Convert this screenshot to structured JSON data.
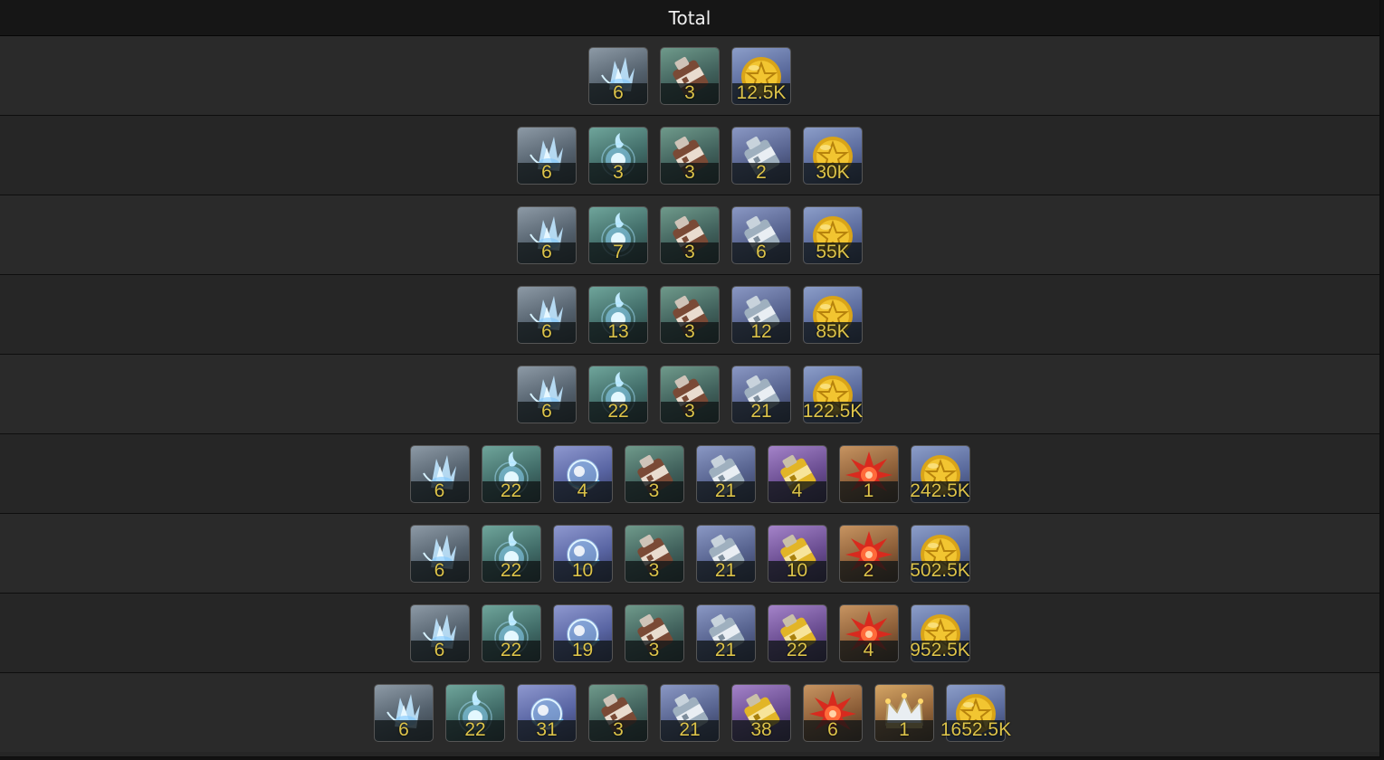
{
  "header": {
    "title": "Total"
  },
  "rows": [
    [
      {
        "icon": "crystal-shard-icon",
        "type": "shard",
        "count": "6"
      },
      {
        "icon": "brown-canister-icon",
        "type": "can-brown",
        "count": "3"
      },
      {
        "icon": "gold-coin-icon",
        "type": "coin",
        "count": "12.5K"
      }
    ],
    [
      {
        "icon": "crystal-shard-icon",
        "type": "shard",
        "count": "6"
      },
      {
        "icon": "spirit-orb-icon",
        "type": "orb",
        "count": "3"
      },
      {
        "icon": "brown-canister-icon",
        "type": "can-brown",
        "count": "3"
      },
      {
        "icon": "silver-canister-icon",
        "type": "can-silver",
        "count": "2"
      },
      {
        "icon": "gold-coin-icon",
        "type": "coin",
        "count": "30K"
      }
    ],
    [
      {
        "icon": "crystal-shard-icon",
        "type": "shard",
        "count": "6"
      },
      {
        "icon": "spirit-orb-icon",
        "type": "orb",
        "count": "7"
      },
      {
        "icon": "brown-canister-icon",
        "type": "can-brown",
        "count": "3"
      },
      {
        "icon": "silver-canister-icon",
        "type": "can-silver",
        "count": "6"
      },
      {
        "icon": "gold-coin-icon",
        "type": "coin",
        "count": "55K"
      }
    ],
    [
      {
        "icon": "crystal-shard-icon",
        "type": "shard",
        "count": "6"
      },
      {
        "icon": "spirit-orb-icon",
        "type": "orb",
        "count": "13"
      },
      {
        "icon": "brown-canister-icon",
        "type": "can-brown",
        "count": "3"
      },
      {
        "icon": "silver-canister-icon",
        "type": "can-silver",
        "count": "12"
      },
      {
        "icon": "gold-coin-icon",
        "type": "coin",
        "count": "85K"
      }
    ],
    [
      {
        "icon": "crystal-shard-icon",
        "type": "shard",
        "count": "6"
      },
      {
        "icon": "spirit-orb-icon",
        "type": "orb",
        "count": "22"
      },
      {
        "icon": "brown-canister-icon",
        "type": "can-brown",
        "count": "3"
      },
      {
        "icon": "silver-canister-icon",
        "type": "can-silver",
        "count": "21"
      },
      {
        "icon": "gold-coin-icon",
        "type": "coin",
        "count": "122.5K"
      }
    ],
    [
      {
        "icon": "crystal-shard-icon",
        "type": "shard",
        "count": "6"
      },
      {
        "icon": "spirit-orb-icon",
        "type": "orb",
        "count": "22"
      },
      {
        "icon": "energy-sphere-icon",
        "type": "sphere",
        "count": "4"
      },
      {
        "icon": "brown-canister-icon",
        "type": "can-brown",
        "count": "3"
      },
      {
        "icon": "silver-canister-icon",
        "type": "can-silver",
        "count": "21"
      },
      {
        "icon": "gold-canister-icon",
        "type": "can-gold",
        "count": "4"
      },
      {
        "icon": "red-burst-icon",
        "type": "burst",
        "count": "1"
      },
      {
        "icon": "gold-coin-icon",
        "type": "coin",
        "count": "242.5K"
      }
    ],
    [
      {
        "icon": "crystal-shard-icon",
        "type": "shard",
        "count": "6"
      },
      {
        "icon": "spirit-orb-icon",
        "type": "orb",
        "count": "22"
      },
      {
        "icon": "energy-sphere-icon",
        "type": "sphere",
        "count": "10"
      },
      {
        "icon": "brown-canister-icon",
        "type": "can-brown",
        "count": "3"
      },
      {
        "icon": "silver-canister-icon",
        "type": "can-silver",
        "count": "21"
      },
      {
        "icon": "gold-canister-icon",
        "type": "can-gold",
        "count": "10"
      },
      {
        "icon": "red-burst-icon",
        "type": "burst",
        "count": "2"
      },
      {
        "icon": "gold-coin-icon",
        "type": "coin",
        "count": "502.5K"
      }
    ],
    [
      {
        "icon": "crystal-shard-icon",
        "type": "shard",
        "count": "6"
      },
      {
        "icon": "spirit-orb-icon",
        "type": "orb",
        "count": "22"
      },
      {
        "icon": "energy-sphere-icon",
        "type": "sphere",
        "count": "19"
      },
      {
        "icon": "brown-canister-icon",
        "type": "can-brown",
        "count": "3"
      },
      {
        "icon": "silver-canister-icon",
        "type": "can-silver",
        "count": "21"
      },
      {
        "icon": "gold-canister-icon",
        "type": "can-gold",
        "count": "22"
      },
      {
        "icon": "red-burst-icon",
        "type": "burst",
        "count": "4"
      },
      {
        "icon": "gold-coin-icon",
        "type": "coin",
        "count": "952.5K"
      }
    ],
    [
      {
        "icon": "crystal-shard-icon",
        "type": "shard",
        "count": "6"
      },
      {
        "icon": "spirit-orb-icon",
        "type": "orb",
        "count": "22"
      },
      {
        "icon": "energy-sphere-icon",
        "type": "sphere",
        "count": "31"
      },
      {
        "icon": "brown-canister-icon",
        "type": "can-brown",
        "count": "3"
      },
      {
        "icon": "silver-canister-icon",
        "type": "can-silver",
        "count": "21"
      },
      {
        "icon": "gold-canister-icon",
        "type": "can-gold",
        "count": "38"
      },
      {
        "icon": "red-burst-icon",
        "type": "burst",
        "count": "6"
      },
      {
        "icon": "crown-icon",
        "type": "crown",
        "count": "1"
      },
      {
        "icon": "gold-coin-icon",
        "type": "coin",
        "count": "1652.5K"
      }
    ]
  ],
  "colors": {
    "count_text": "#dcc34a",
    "header_bg": "#161616",
    "row_bg": "#262626"
  }
}
